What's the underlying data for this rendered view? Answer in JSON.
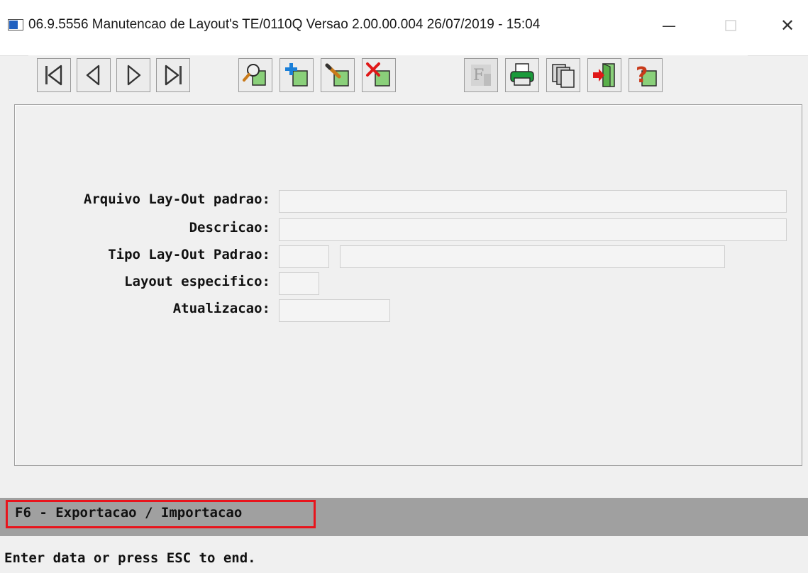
{
  "window": {
    "title": "06.9.5556 Manutencao  de Layout's TE/0110Q Versao 2.00.00.004 26/07/2019 - 15:04",
    "minimize_glyph": "—",
    "close_glyph": "✕"
  },
  "toolbar": {
    "buttons": [
      {
        "name": "first-record",
        "icon": "first-icon",
        "enabled": true
      },
      {
        "name": "previous-record",
        "icon": "previous-icon",
        "enabled": true
      },
      {
        "name": "next-record",
        "icon": "next-icon",
        "enabled": true
      },
      {
        "name": "last-record",
        "icon": "last-icon",
        "enabled": true
      },
      {
        "name": "search",
        "icon": "search-icon",
        "enabled": true
      },
      {
        "name": "add",
        "icon": "add-icon",
        "enabled": true
      },
      {
        "name": "edit",
        "icon": "edit-icon",
        "enabled": true
      },
      {
        "name": "delete",
        "icon": "delete-icon",
        "enabled": true
      },
      {
        "name": "filter",
        "icon": "filter-icon",
        "enabled": false
      },
      {
        "name": "print",
        "icon": "print-icon",
        "enabled": true
      },
      {
        "name": "copy",
        "icon": "copy-icon",
        "enabled": true
      },
      {
        "name": "exit",
        "icon": "exit-icon",
        "enabled": true
      },
      {
        "name": "help",
        "icon": "help-icon",
        "enabled": true
      }
    ]
  },
  "form": {
    "arquivo_label": "Arquivo Lay-Out padrao:",
    "arquivo_value": "",
    "descricao_label": "Descricao:",
    "descricao_value": "",
    "tipo_label": "Tipo Lay-Out Padrao:",
    "tipo_code_value": "",
    "tipo_desc_value": "",
    "especifico_label": "Layout especifico:",
    "especifico_value": "",
    "atualizacao_label": "Atualizacao:",
    "atualizacao_value": ""
  },
  "function_keys": {
    "f6_label": "F6 - Exportacao / Importacao"
  },
  "status": {
    "message": "Enter data or press ESC to end."
  },
  "colors": {
    "highlight_border": "#e8141c",
    "accent_green": "#1a9a3a",
    "accent_blue": "#1a7fd8",
    "icon_outline": "#2a2a2a"
  }
}
